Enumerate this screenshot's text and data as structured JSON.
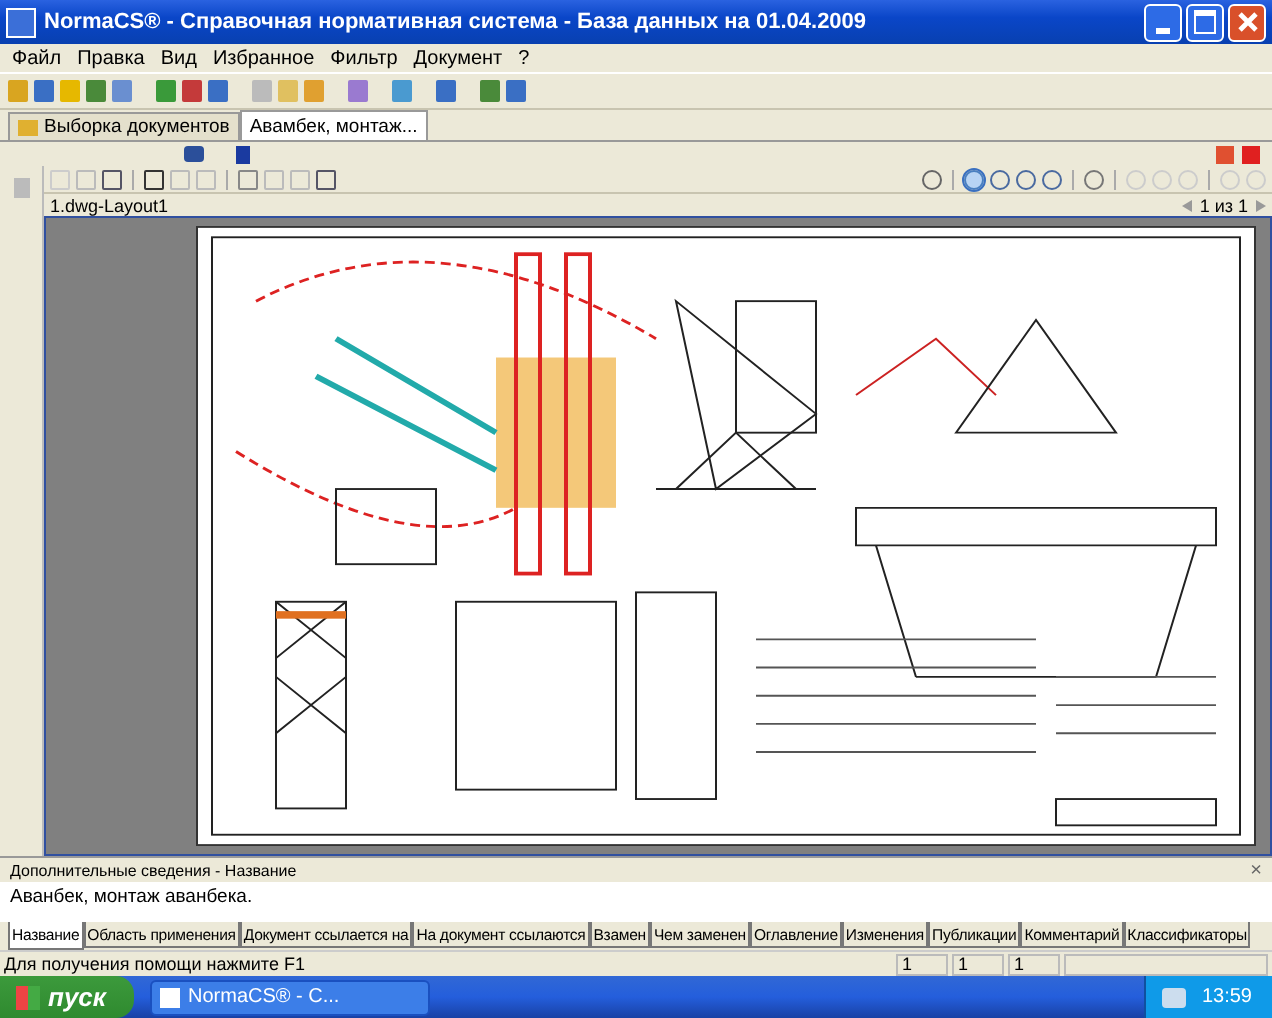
{
  "window": {
    "title": "NormaCS® - Справочная нормативная система - База данных на 01.04.2009"
  },
  "menu": [
    "Файл",
    "Правка",
    "Вид",
    "Избранное",
    "Фильтр",
    "Документ",
    "?"
  ],
  "doc_tabs": [
    {
      "label": "Выборка документов",
      "selected": false
    },
    {
      "label": "Авамбек, монтаж...",
      "selected": true
    }
  ],
  "viewer": {
    "layout": "1.dwg-Layout1",
    "page": "1 из 1"
  },
  "info_panel": {
    "title": "Дополнительные сведения - Название",
    "close": "×",
    "text": "Аванбек, монтаж аванбека."
  },
  "bottom_tabs": [
    {
      "label": "Название",
      "selected": true
    },
    {
      "label": "Область применения",
      "selected": false
    },
    {
      "label": "Документ ссылается на",
      "selected": false
    },
    {
      "label": "На документ ссылаются",
      "selected": false
    },
    {
      "label": "Взамен",
      "selected": false
    },
    {
      "label": "Чем заменен",
      "selected": false
    },
    {
      "label": "Оглавление",
      "selected": false
    },
    {
      "label": "Изменения",
      "selected": false
    },
    {
      "label": "Публикации",
      "selected": false
    },
    {
      "label": "Комментарий",
      "selected": false
    },
    {
      "label": "Классификаторы",
      "selected": false
    }
  ],
  "status_bar": {
    "hint": "Для получения помощи нажмите F1",
    "cells": [
      "1",
      "1",
      "1"
    ]
  },
  "taskbar": {
    "start": "пуск",
    "task": "NormaCS® - C...",
    "clock": "13:59"
  }
}
